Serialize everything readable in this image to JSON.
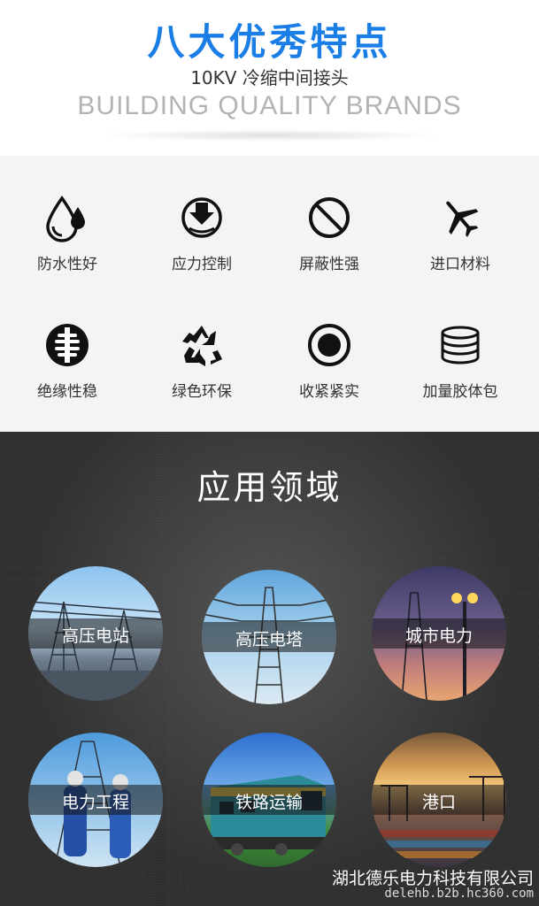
{
  "header": {
    "title": "八大优秀特点",
    "subtitle": "10KV 冷缩中间接头",
    "brand": "BUILDING QUALITY BRANDS"
  },
  "features": [
    {
      "label": "防水性好",
      "icon": "water-drop-icon"
    },
    {
      "label": "应力控制",
      "icon": "stress-control-icon"
    },
    {
      "label": "屏蔽性强",
      "icon": "prohibit-icon"
    },
    {
      "label": "进口材料",
      "icon": "airplane-icon"
    },
    {
      "label": "绝缘性稳",
      "icon": "insulator-icon"
    },
    {
      "label": "绿色环保",
      "icon": "recycle-icon"
    },
    {
      "label": "收紧紧实",
      "icon": "target-circle-icon"
    },
    {
      "label": "加量胶体包",
      "icon": "stack-icon"
    }
  ],
  "applications": {
    "title": "应用领域",
    "items": [
      {
        "label": "高压电站"
      },
      {
        "label": "高压电塔"
      },
      {
        "label": "城市电力"
      },
      {
        "label": "电力工程"
      },
      {
        "label": "铁路运输"
      },
      {
        "label": "港口"
      }
    ]
  },
  "footer": {
    "company": "湖北德乐电力科技有限公司",
    "url": "delehb.b2b.hc360.com"
  },
  "colors": {
    "title_blue": "#1a7ee6",
    "feature_bg": "#f4f4f4",
    "apps_bg": "#2f2f2f"
  }
}
